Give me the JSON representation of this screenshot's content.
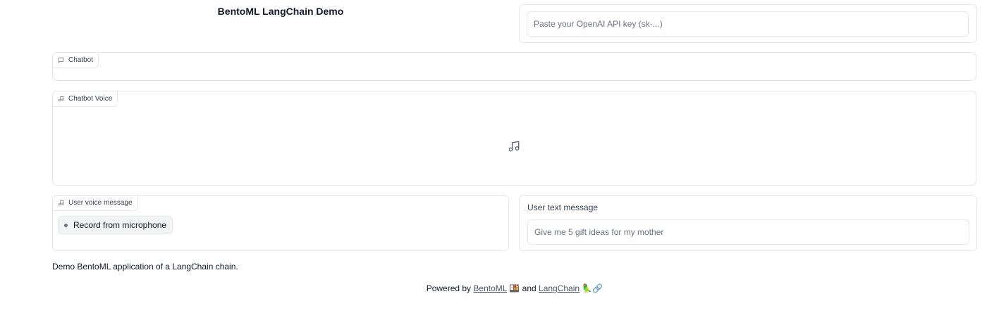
{
  "header": {
    "title": "BentoML LangChain Demo"
  },
  "api_key": {
    "placeholder": "Paste your OpenAI API key (sk-...)",
    "value": ""
  },
  "chatbot": {
    "label": "Chatbot"
  },
  "chatbot_voice": {
    "label": "Chatbot Voice"
  },
  "user_voice": {
    "label": "User voice message",
    "record_label": "Record from microphone"
  },
  "user_text": {
    "label": "User text message",
    "placeholder": "Give me 5 gift ideas for my mother",
    "value": ""
  },
  "description": "Demo BentoML application of a LangChain chain.",
  "footer": {
    "prefix": "Powered by",
    "bentoml_link": "BentoML",
    "bentoml_emoji": "🍱",
    "conjunction": "and",
    "langchain_link": "LangChain",
    "langchain_emoji": "🦜🔗"
  }
}
